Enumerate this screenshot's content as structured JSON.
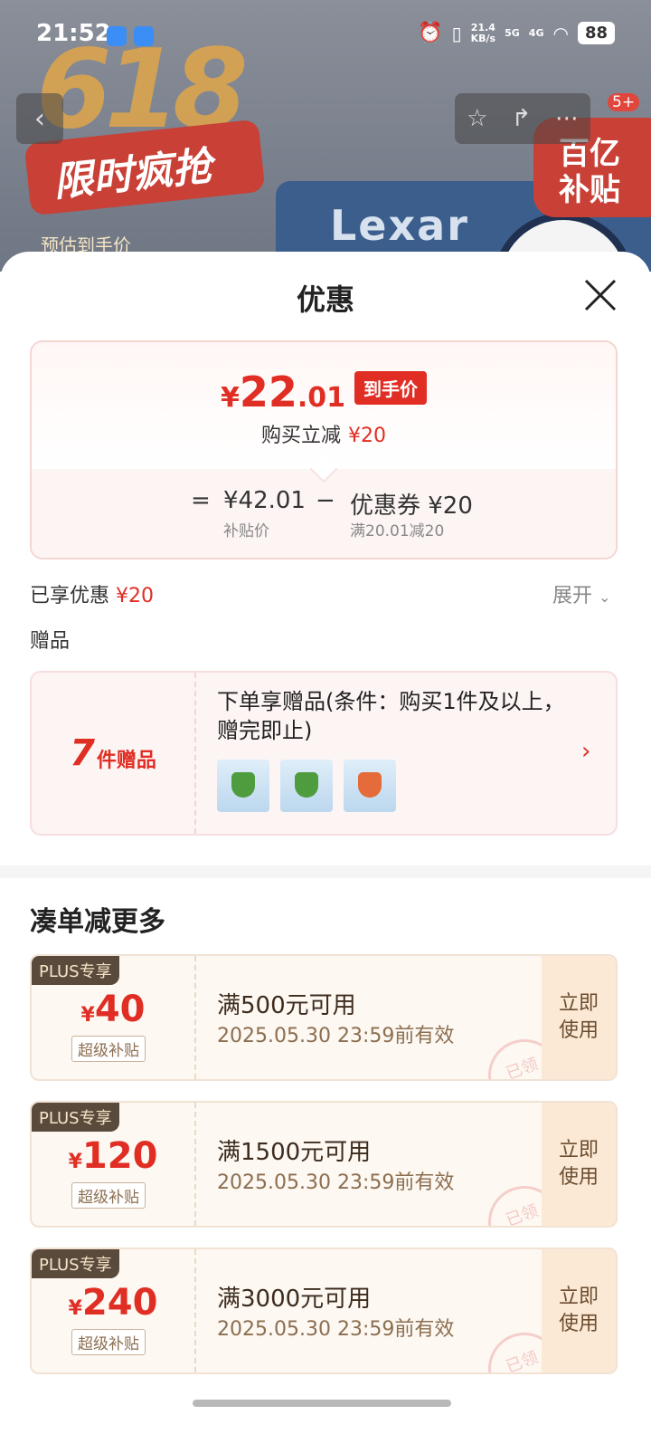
{
  "status_bar": {
    "time": "21:52",
    "net_speed_value": "21.4",
    "net_speed_unit": "KB/s",
    "sig1": "5G",
    "sig2": "4G",
    "battery": "88"
  },
  "background": {
    "promo_number": "618",
    "promo_title": "限时疯抢",
    "promo_sub": "预估到手价",
    "brand": "Lexar",
    "badge": "百亿补贴",
    "nav_badge": "5+"
  },
  "sheet": {
    "title": "优惠",
    "price": {
      "currency": "¥",
      "integer": "22",
      "decimal": ".01",
      "tag": "到手价",
      "sub_label": "购买立减",
      "sub_amount": "¥20"
    },
    "formula": {
      "eq": "=",
      "subsidy_price": "¥42.01",
      "subsidy_label": "补贴价",
      "minus": "−",
      "coupon": "优惠券 ¥20",
      "coupon_rule": "满20.01减20"
    },
    "enjoyed_label": "已享优惠",
    "enjoyed_amount": "¥20",
    "expand_label": "展开",
    "gifts_label": "赠品",
    "gift": {
      "count": "7",
      "count_label": "件赠品",
      "desc": "下单享赠品(条件：购买1件及以上，赠完即止)"
    },
    "section_title": "凑单减更多",
    "coupons": [
      {
        "tag": "PLUS专享",
        "yen": "¥",
        "amount": "40",
        "sub": "超级补贴",
        "title": "满500元可用",
        "date": "2025.05.30 23:59前有效",
        "stamp": "已领",
        "action": "立即使用"
      },
      {
        "tag": "PLUS专享",
        "yen": "¥",
        "amount": "120",
        "sub": "超级补贴",
        "title": "满1500元可用",
        "date": "2025.05.30 23:59前有效",
        "stamp": "已领",
        "action": "立即使用"
      },
      {
        "tag": "PLUS专享",
        "yen": "¥",
        "amount": "240",
        "sub": "超级补贴",
        "title": "满3000元可用",
        "date": "2025.05.30 23:59前有效",
        "stamp": "已领",
        "action": "立即使用"
      }
    ]
  }
}
